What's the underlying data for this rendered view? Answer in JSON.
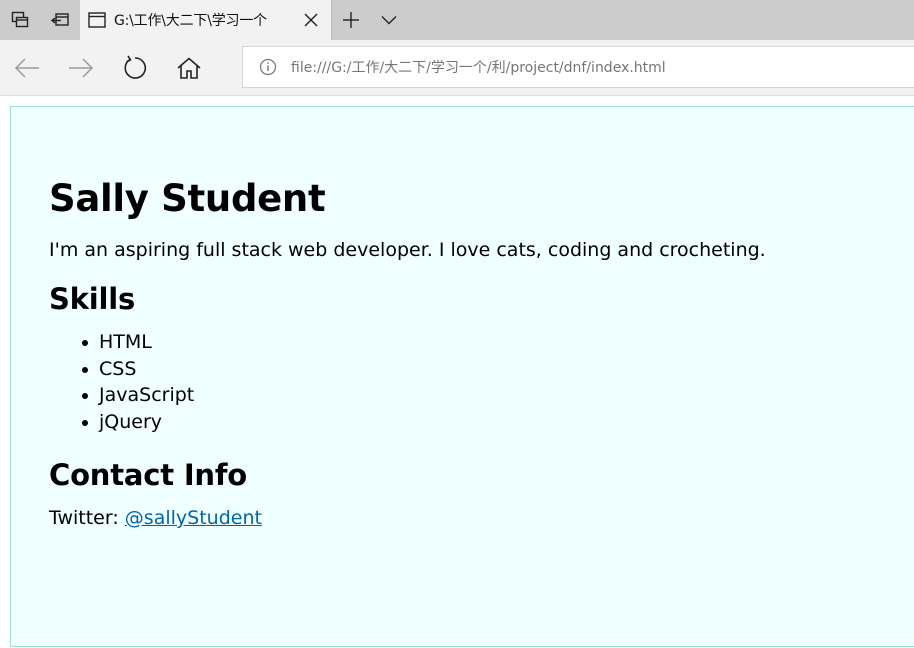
{
  "browser": {
    "tab": {
      "title": "G:\\工作\\大二下\\学习一个"
    },
    "address": {
      "url": "file:///G:/工作/大二下/学习一个/利/project/dnf/index.html"
    }
  },
  "page": {
    "name": "Sally Student",
    "bio": "I'm an aspiring full stack web developer. I love cats, coding and crocheting.",
    "skills_heading": "Skills",
    "skills": [
      "HTML",
      "CSS",
      "JavaScript",
      "jQuery"
    ],
    "contact_heading": "Contact Info",
    "twitter_label": "Twitter: ",
    "twitter_handle": "@sallyStudent"
  },
  "colors": {
    "page_background": "#f0ffff",
    "page_border": "#98e0d8",
    "link": "#0066aa",
    "tabbar": "#cccccc",
    "toolbar": "#f2f2f2"
  },
  "icons": {
    "tab_actions": [
      "tab-preview-icon",
      "set-tabs-aside-icon"
    ],
    "tab": "page-icon",
    "tab_close": "close-icon",
    "new_tab": "plus-icon",
    "tab_list": "chevron-down-icon",
    "nav": [
      "back-arrow-icon",
      "forward-arrow-icon",
      "refresh-icon",
      "home-icon"
    ],
    "address": "info-icon"
  }
}
